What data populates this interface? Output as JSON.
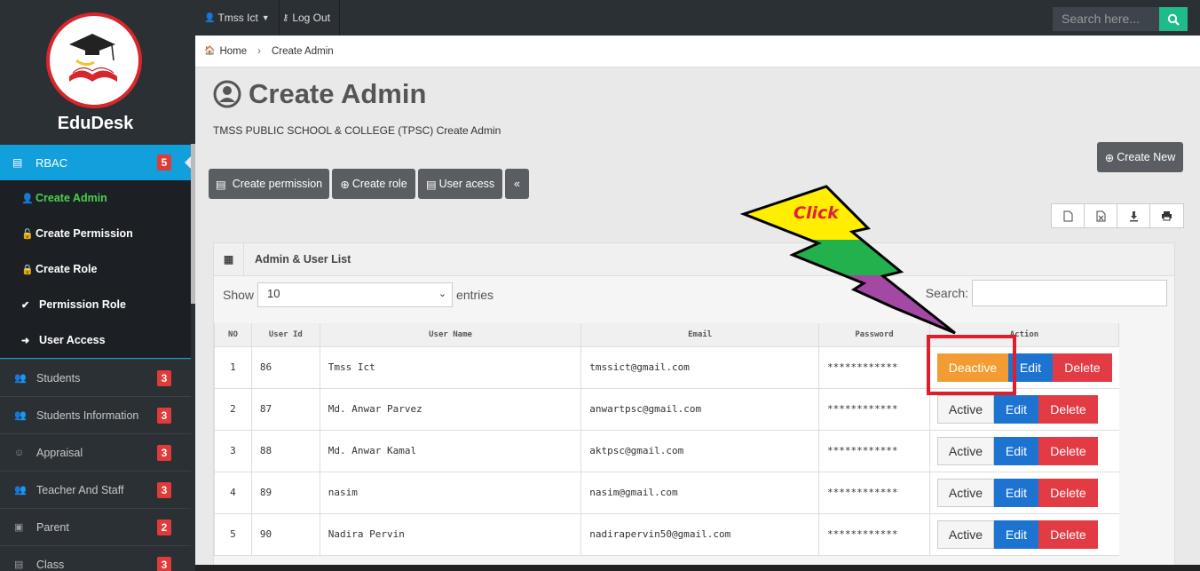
{
  "brand": "EduDesk",
  "colors": {
    "sidebar": "#2b3035",
    "accent": "#11a0dc",
    "active_green": "#4cd14c",
    "badge": "#e03b3b",
    "deactive": "#f39c33",
    "edit": "#1c74d0",
    "delete": "#e23b44",
    "highlight": "#e11d2b"
  },
  "topbar": {
    "user": "Tmss Ict",
    "logout": "Log Out",
    "search_placeholder": "Search here..."
  },
  "sidebar": {
    "rbac": {
      "label": "RBAC",
      "badge": "5"
    },
    "submenu": [
      {
        "label": "Create Admin",
        "icon": "user-plus-icon"
      },
      {
        "label": "Create Permission",
        "icon": "unlock-icon"
      },
      {
        "label": "Create Role",
        "icon": "lock-icon"
      },
      {
        "label": "Permission Role",
        "icon": "check-icon"
      },
      {
        "label": "User Access",
        "icon": "sign-in-icon"
      }
    ],
    "items": [
      {
        "label": "Students",
        "badge": "3",
        "icon": "users-icon"
      },
      {
        "label": "Students Information",
        "badge": "3",
        "icon": "users-icon"
      },
      {
        "label": "Appraisal",
        "badge": "3",
        "icon": "smile-icon"
      },
      {
        "label": "Teacher And Staff",
        "badge": "3",
        "icon": "users-icon"
      },
      {
        "label": "Parent",
        "badge": "2",
        "icon": "book-icon"
      },
      {
        "label": "Class",
        "badge": "3",
        "icon": "list-icon"
      }
    ]
  },
  "breadcrumb": {
    "home": "Home",
    "current": "Create Admin"
  },
  "page": {
    "title": "Create Admin",
    "subtitle": "TMSS PUBLIC SCHOOL & COLLEGE (TPSC) Create Admin"
  },
  "buttons": {
    "create_new": "Create New",
    "create_permission": "Create permission",
    "create_role": "Create role",
    "user_access": "User acess",
    "collapse": "«"
  },
  "annotation": {
    "click": "Click"
  },
  "panel": {
    "title": "Admin & User List",
    "show": "Show",
    "entries": "entries",
    "page_size": "10",
    "search_label": "Search:"
  },
  "table": {
    "headers": [
      "NO",
      "User Id",
      "User Name",
      "Email",
      "Password",
      "Action"
    ],
    "rows": [
      {
        "no": "1",
        "id": "86",
        "name": "Tmss Ict",
        "email": "tmssict@gmail.com",
        "password": "************",
        "status_btn": "Deactive"
      },
      {
        "no": "2",
        "id": "87",
        "name": "Md. Anwar Parvez",
        "email": "anwartpsc@gmail.com",
        "password": "************",
        "status_btn": "Active"
      },
      {
        "no": "3",
        "id": "88",
        "name": "Md. Anwar Kamal",
        "email": "aktpsc@gmail.com",
        "password": "************",
        "status_btn": "Active"
      },
      {
        "no": "4",
        "id": "89",
        "name": "nasim",
        "email": "nasim@gmail.com",
        "password": "************",
        "status_btn": "Active"
      },
      {
        "no": "5",
        "id": "90",
        "name": "Nadira Pervin",
        "email": "nadirapervin50@gmail.com",
        "password": "************",
        "status_btn": "Active"
      }
    ],
    "edit": "Edit",
    "delete": "Delete"
  }
}
